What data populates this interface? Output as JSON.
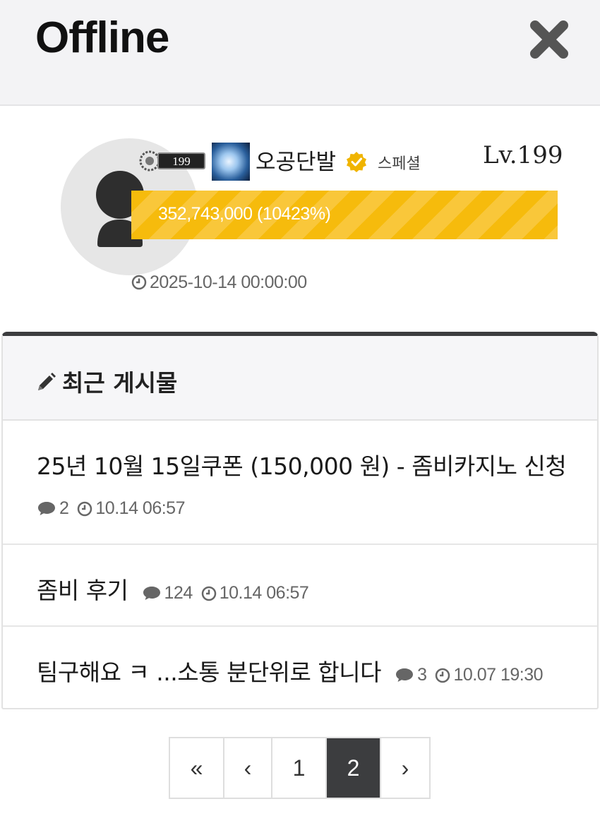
{
  "header": {
    "title": "Offline",
    "close_icon": "close-icon"
  },
  "profile": {
    "level_badge": "199",
    "nickname": "오공단발",
    "role": "스페셜",
    "level": "Lv.199",
    "exp_text": "352,743,000 (10423%)",
    "exp_percent": 100,
    "registered": "2025-10-14 00:00:00",
    "colors": {
      "exp_bar": "#f6bb0c",
      "verify_badge": "#f0b400"
    }
  },
  "recent_posts": {
    "title": "최근 게시물",
    "items": [
      {
        "title": "25년 10월 15일쿠폰 (150,000 원) - 좀비카지노 신청",
        "comments": "2",
        "time": "10.14 06:57"
      },
      {
        "title": "좀비 후기",
        "comments": "124",
        "time": "10.14 06:57"
      },
      {
        "title": "팀구해요 ㅋ ...소통 분단위로 합니다",
        "comments": "3",
        "time": "10.07 19:30"
      }
    ]
  },
  "pagination": {
    "first": "«",
    "prev": "‹",
    "pages": [
      "1",
      "2"
    ],
    "current": "2",
    "next": "›"
  }
}
